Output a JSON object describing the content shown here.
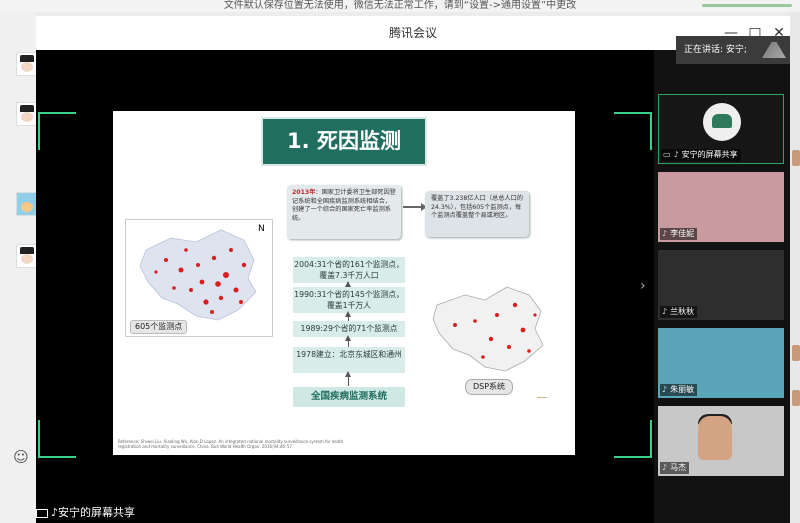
{
  "notice": {
    "text": "文件默认保存位置无法使用，微信无法正常工作，请到“设置->通用设置”中更改"
  },
  "window": {
    "title": "腾讯会议",
    "minimize": "—",
    "maximize": "□",
    "close": "✕"
  },
  "speaking": {
    "label": "正在讲话: 安宁;"
  },
  "slide": {
    "title": "1. 死因监测",
    "box_2013": {
      "year": "2013年",
      "text": "：国家卫计委将卫生部死因登记系统和全国疾病监测系统相结合，创建了一个综合的国家死亡率监测系统。"
    },
    "box_cover": {
      "text": "覆盖了3.238亿人口（总总人口的24.3%），包括605个监测点，每个监测点覆盖整个县或地区。"
    },
    "timeline": [
      {
        "text": "2004:31个省的161个监测点，覆盖7.3千万人口"
      },
      {
        "text": "1990:31个省的145个监测点，覆盖1千万人"
      },
      {
        "text": "1989:29个省的71个监测点"
      },
      {
        "text": "1978建立：北京东城区和通州"
      }
    ],
    "timeline_base": "全国疾病监测系统",
    "map_label": "605个监测点",
    "dsp_label": "DSP系统",
    "north": "N",
    "reference": "Reference: Shiwei Liu, Xiaoling Wu, Alan D Lopez. An integrated national mortality surveillance system for death registration and mortality surveillance, China. Bull World Health Organ. 2016;94:46–57"
  },
  "participants": [
    {
      "name": "安宁的屏幕共享",
      "active": true
    },
    {
      "name": "李佳妮",
      "active": false,
      "color": "#c99aa0"
    },
    {
      "name": "兰秋秋",
      "active": false,
      "color": "#3a3a3a"
    },
    {
      "name": "朱丽敏",
      "active": false,
      "color": "#5aa6b8"
    },
    {
      "name": "马杰",
      "active": false,
      "color": "#c8c8c8"
    }
  ],
  "bottom": {
    "share_label": "安宁的屏幕共享"
  },
  "icons": {
    "mic": "mic-icon",
    "screen": "screen-share-icon",
    "emoji": "emoji-icon",
    "arrow": "chevron-right-icon"
  }
}
